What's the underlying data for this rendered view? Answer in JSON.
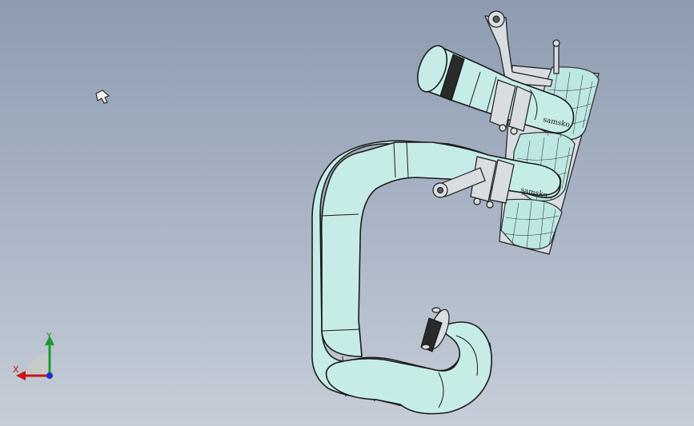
{
  "viewport": {
    "background_top": "#8e9bb0",
    "background_bottom": "#c6cdd8",
    "model_color": "#c6ece8",
    "outline_color": "#1b1b1b"
  },
  "model": {
    "brand_marking_upper": "samsko",
    "brand_marking_lower": "samsko"
  },
  "triad": {
    "x_label": "X",
    "y_label": "Y",
    "x_color": "#c81414",
    "y_color": "#1c9a2e",
    "z_color": "#1a2fc8"
  },
  "icons": {
    "cursor": "cursor-icon"
  }
}
